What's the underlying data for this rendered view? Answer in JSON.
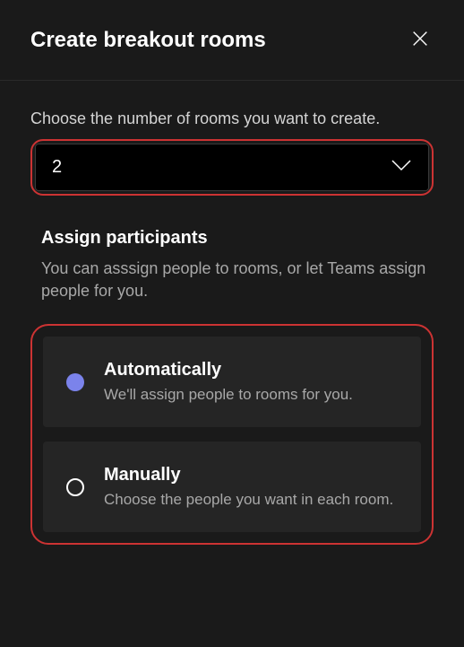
{
  "header": {
    "title": "Create breakout rooms"
  },
  "roomCount": {
    "instruction": "Choose the number of rooms you want to create.",
    "value": "2"
  },
  "assign": {
    "title": "Assign participants",
    "description": "You can asssign people to rooms, or let Teams assign people for you.",
    "options": [
      {
        "label": "Automatically",
        "description": "We'll assign people to rooms for you.",
        "selected": true
      },
      {
        "label": "Manually",
        "description": "Choose the people you want in each room.",
        "selected": false
      }
    ]
  }
}
